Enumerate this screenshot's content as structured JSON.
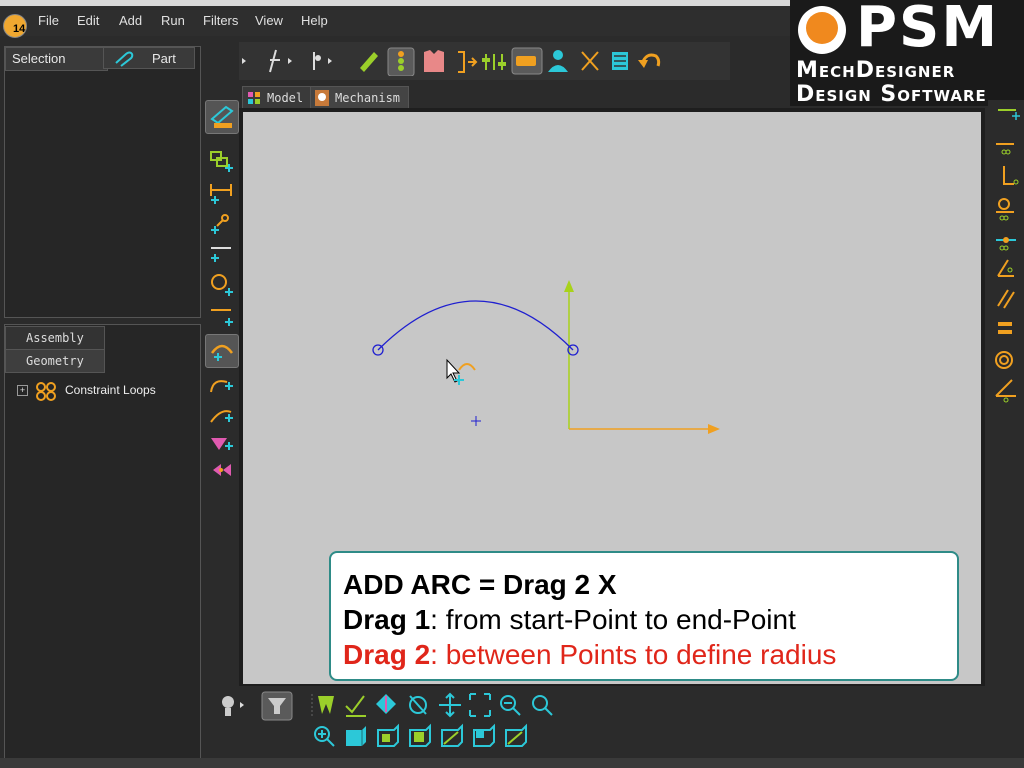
{
  "app": {
    "icon_label": "14"
  },
  "menu": [
    "File",
    "Edit",
    "Add",
    "Run",
    "Filters",
    "View",
    "Help"
  ],
  "left_panel": {
    "headers": [
      "Selection",
      "Part"
    ]
  },
  "tree_panel": {
    "tabs": [
      "Assembly",
      "Geometry"
    ],
    "active_tab": "Geometry",
    "items": [
      {
        "label": "Constraint Loops",
        "expander": "+"
      }
    ]
  },
  "doc_tabs": [
    {
      "label": "Model",
      "icon": "model-icon"
    },
    {
      "label": "Mechanism",
      "icon": "mechanism-icon"
    }
  ],
  "logo": {
    "brand": "PSM",
    "line1": "MechDesigner",
    "line2": "Design Software"
  },
  "callout": {
    "title": "ADD ARC = Drag 2 X",
    "drag1_label": "Drag 1",
    "drag1_text": ": from start-Point to end-Point",
    "drag2_label": "Drag 2",
    "drag2_text": ": between Points to define radius"
  },
  "colors": {
    "accent_cyan": "#2cc8d8",
    "accent_orange": "#f0a020",
    "accent_green": "#9bcf2a",
    "arc_blue": "#1f1fd0",
    "callout_border": "#2e8b87",
    "callout_red": "#e0261a"
  }
}
